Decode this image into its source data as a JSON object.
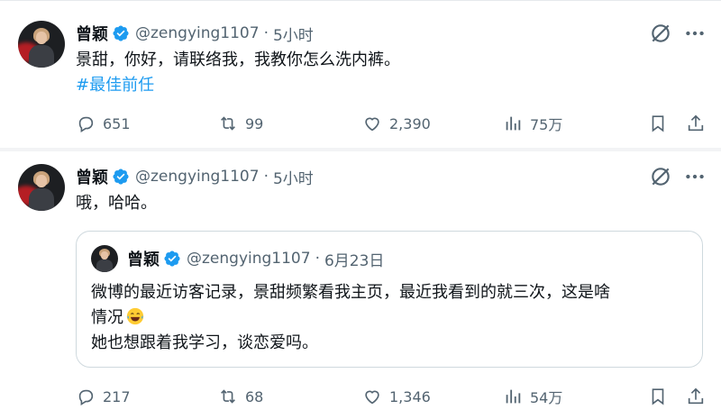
{
  "tweets": [
    {
      "author_name": "曾颖",
      "handle": "@zengying1107",
      "separator": "·",
      "time": "5小时",
      "text_line1": "景甜，你好，请联络我，我教你怎么洗内裤。",
      "hashtag": "#最佳前任",
      "replies": "651",
      "retweets": "99",
      "likes": "2,390",
      "views": "75万"
    },
    {
      "author_name": "曾颖",
      "handle": "@zengying1107",
      "separator": "·",
      "time": "5小时",
      "text_line1": "哦，哈哈。",
      "quote": {
        "author_name": "曾颖",
        "handle": "@zengying1107",
        "separator": "·",
        "date": "6月23日",
        "line1": "微博的最近访客记录，景甜频繁看我主页，最近我看到的就三次，这是啥",
        "line2": "情况",
        "line3": "她也想跟着我学习，谈恋爱吗。"
      },
      "replies": "217",
      "retweets": "68",
      "likes": "1,346",
      "views": "54万"
    }
  ],
  "colors": {
    "accent": "#1d9bf0",
    "secondary_text": "#536471",
    "primary_text": "#0f1419",
    "border": "#cfd9de"
  },
  "icons": [
    "verified-badge-icon",
    "grok-icon",
    "more-icon",
    "reply-icon",
    "retweet-icon",
    "like-icon",
    "views-icon",
    "bookmark-icon",
    "share-icon",
    "laughing-tears-emoji"
  ]
}
